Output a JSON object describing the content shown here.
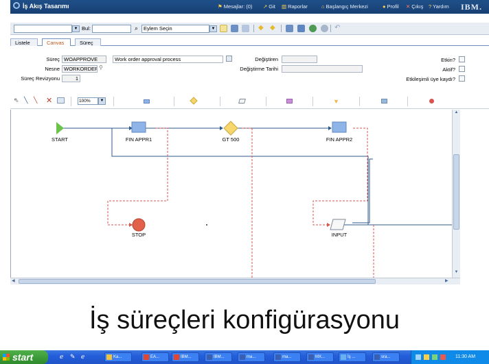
{
  "header": {
    "title": "İş Akış Tasarımı",
    "links": [
      {
        "label": "Mesajlar: (0)",
        "icon": "flag-icon"
      },
      {
        "label": "Git",
        "icon": "arrow-icon"
      },
      {
        "label": "Raporlar",
        "icon": "chart-icon"
      },
      {
        "label": "Başlangıç Merkezi",
        "icon": "home-icon"
      },
      {
        "label": "Profil",
        "icon": "person-icon"
      },
      {
        "label": "Çıkış",
        "icon": "x-icon"
      },
      {
        "label": "Yardım",
        "icon": "question-icon"
      }
    ],
    "logo": "IBM."
  },
  "toolbar": {
    "find_label": "Bul:",
    "find_value": "",
    "action_select": "Eylem Seçin"
  },
  "tabs": [
    "Listele",
    "Canvas",
    "Süreç"
  ],
  "active_tab": "Canvas",
  "form": {
    "process_label": "Süreç",
    "process_value": "WOAPPROVE",
    "process_desc": "Work order approval process",
    "object_label": "Nesne",
    "object_value": "WORKORDER",
    "revision_label": "Süreç Revizyonu",
    "revision_value": "1",
    "changedby_label": "Değiştiren",
    "changedby_value": "",
    "changedate_label": "Değiştirme Tarihi",
    "changedate_value": "",
    "enabled_label": "Etkin?",
    "active_label": "Aktif?",
    "interactive_label": "Etkileşimli üye kaydı?"
  },
  "palette": {
    "zoom": "100%"
  },
  "nodes": {
    "start": "START",
    "finappr1": "FIN APPR1",
    "gt500": "GT 500",
    "finappr2": "FIN APPR2",
    "stop": "STOP",
    "input": "INPUT"
  },
  "caption": "İş süreçleri konfigürasyonu",
  "taskbar": {
    "start": "start",
    "tasks": [
      "Ka...",
      "EA...",
      "IBM...",
      "IBM...",
      "ma...",
      "ma...",
      "MX...",
      "İş ...",
      "sra..."
    ],
    "clock": "11:30 AM"
  },
  "colors": {
    "header_bg": "#1f4f87",
    "node_blue": "#8fb4e8",
    "decision": "#f5d76e",
    "stop": "#e2614a",
    "start": "#6cc24a",
    "negative_line": "#d9534f",
    "positive_line": "#2c5a8c"
  }
}
